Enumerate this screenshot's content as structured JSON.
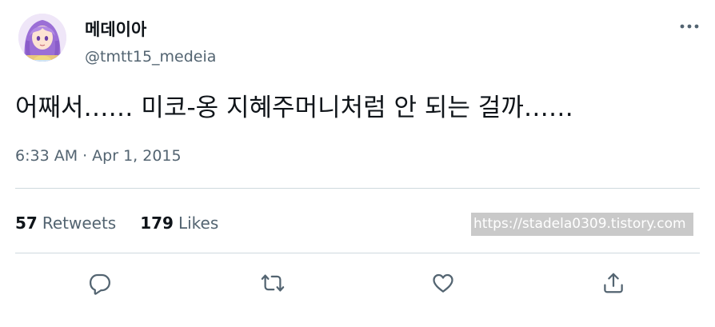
{
  "author": {
    "display_name": "메데이아",
    "handle": "@tmtt15_medeia",
    "avatar_icon": "anime-girl-avatar"
  },
  "tweet": {
    "text": "어째서…… 미코-옹 지혜주머니처럼 안 되는 걸까……",
    "time": "6:33 AM",
    "separator": "·",
    "date": "Apr 1, 2015"
  },
  "stats": {
    "retweets_count": "57",
    "retweets_label": "Retweets",
    "likes_count": "179",
    "likes_label": "Likes"
  },
  "watermark": {
    "text": "https://stadela0309.tistory.com"
  },
  "actions": [
    {
      "name": "reply",
      "icon": "reply-icon"
    },
    {
      "name": "retweet",
      "icon": "retweet-icon"
    },
    {
      "name": "like",
      "icon": "heart-icon"
    },
    {
      "name": "share",
      "icon": "share-icon"
    }
  ],
  "colors": {
    "primary_text": "#0f1419",
    "secondary_text": "#536471",
    "divider": "#cfd9de",
    "watermark_bg": "#c9c9c9"
  }
}
